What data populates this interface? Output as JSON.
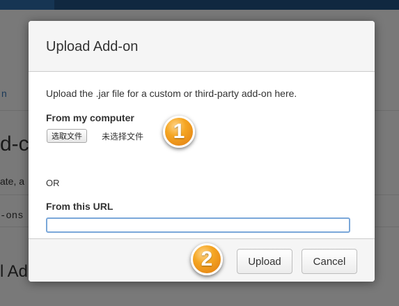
{
  "background": {
    "fragments": [
      "n",
      "d-c",
      "ate, a",
      "-ons",
      "l Ad"
    ]
  },
  "dialog": {
    "title": "Upload Add-on",
    "intro": "Upload the .jar file for a custom or third-party add-on here.",
    "from_computer_label": "From my computer",
    "file_button_label": "选取文件",
    "file_status": "未选择文件",
    "or_label": "OR",
    "from_url_label": "From this URL",
    "url_value": "",
    "upload_button": "Upload",
    "cancel_button": "Cancel"
  },
  "markers": {
    "step1": "1",
    "step2": "2"
  },
  "colors": {
    "accent_blue": "#205081",
    "marker_orange": "#f5a623",
    "input_focus_border": "#7aa7d9"
  }
}
